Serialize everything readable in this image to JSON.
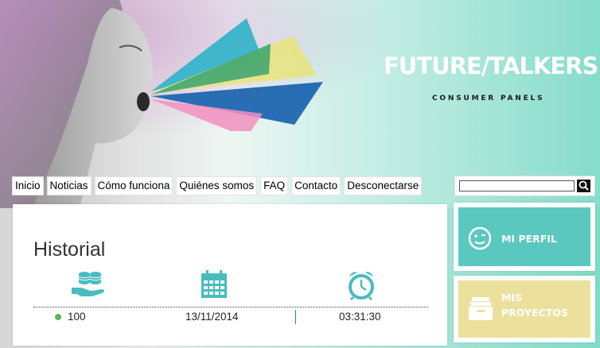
{
  "brand": {
    "logo_text": "FUTURE/TALKERS",
    "tagline": "CONSUMER PANELS"
  },
  "colors": {
    "teal": "#5ac8be",
    "yellow": "#ebe19c",
    "beam_cyan": "#2eb3c9",
    "beam_green": "#3aa46f",
    "beam_blue": "#1f66b0",
    "beam_pink": "#f28fc0",
    "beam_yellow": "#e9e47a"
  },
  "nav": {
    "items": [
      "Inicio",
      "Noticias",
      "Cómo funciona",
      "Quiénes somos",
      "FAQ",
      "Contacto",
      "Desconectarse"
    ]
  },
  "search": {
    "value": "",
    "icon": "search-icon"
  },
  "history": {
    "title": "Historial",
    "icons": [
      "coins-hand-icon",
      "calendar-icon",
      "alarm-clock-icon"
    ],
    "rows": [
      {
        "points": "100",
        "date": "13/11/2014",
        "time": "03:31:30"
      }
    ]
  },
  "sidebar": {
    "profile_label": "MI PERFIL",
    "projects_label_1": "MIS",
    "projects_label_2": "PROYECTOS"
  }
}
